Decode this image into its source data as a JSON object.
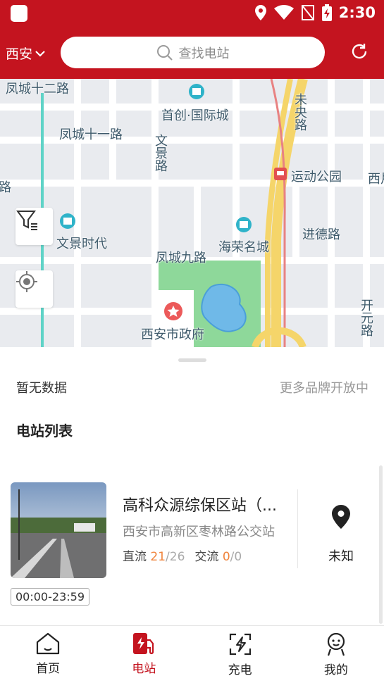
{
  "status_bar": {
    "time": "2:30"
  },
  "header": {
    "city": "西安",
    "search_placeholder": "查找电站"
  },
  "map": {
    "labels": {
      "fengcheng12": "凤城十二路",
      "shouchuang": "首创·国际城",
      "fengcheng11": "凤城十一路",
      "wenjinglu": "文景路",
      "weiyanglu": "未央路",
      "yundong": "运动公园",
      "xi": "西片",
      "lu_left": "路",
      "wenjing_shidai": "文景时代",
      "haironga": "海荣名城",
      "jinde": "进德路",
      "fengcheng9": "凤城九路",
      "shizhengfu": "西安市政府",
      "kaiyuan": "开元路"
    }
  },
  "sheet": {
    "no_data": "暂无数据",
    "more_brands": "更多品牌开放中",
    "list_title": "电站列表"
  },
  "stations": [
    {
      "name": "高科众源综保区站（...",
      "address": "西安市高新区枣林路公交站",
      "dc_label": "直流",
      "dc_available": "21",
      "dc_total": "/26",
      "ac_label": "交流",
      "ac_available": "0",
      "ac_total": "/0",
      "distance": "未知",
      "hours": "00:00-23:59"
    }
  ],
  "nav": [
    {
      "label": "首页",
      "icon": "home-icon"
    },
    {
      "label": "电站",
      "icon": "charging-station-icon"
    },
    {
      "label": "充电",
      "icon": "charge-icon"
    },
    {
      "label": "我的",
      "icon": "profile-icon"
    }
  ],
  "colors": {
    "brand_red": "#c4141f",
    "accent_orange": "#f0843c"
  }
}
